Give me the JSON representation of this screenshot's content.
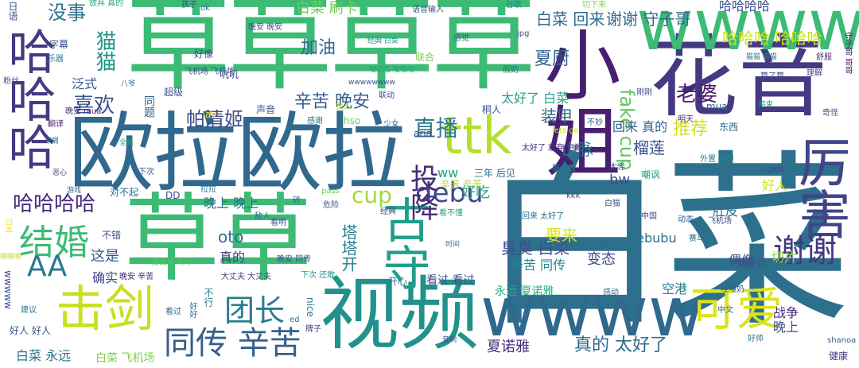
{
  "words": [
    {
      "text": "白菜",
      "color": "#2d708e"
    },
    {
      "text": "草草草草",
      "color": "#3cbb75"
    },
    {
      "text": "欧拉欧拉",
      "color": "#31688e"
    },
    {
      "text": "花音",
      "color": "#443983"
    },
    {
      "text": "小姐",
      "color": "#481f70"
    },
    {
      "text": "草草",
      "color": "#3cbb75"
    },
    {
      "text": "wwwwww",
      "color": "#3cbb75"
    },
    {
      "text": "视频",
      "color": "#21918c"
    },
    {
      "text": "wwww",
      "color": "#31688e"
    },
    {
      "text": "击剑",
      "color": "#c8e020"
    },
    {
      "text": "哈哈哈",
      "color": "#443983"
    },
    {
      "text": "ttk",
      "color": "#b5de2b"
    },
    {
      "text": "古守",
      "color": "#1f9e89"
    },
    {
      "text": "厉害",
      "color": "#414487"
    },
    {
      "text": "可爱",
      "color": "#dde318"
    },
    {
      "text": "结婚",
      "color": "#3cbb75"
    },
    {
      "text": "同传 辛苦",
      "color": "#355f8d"
    },
    {
      "text": "谢谢",
      "color": "#453781"
    },
    {
      "text": "团长",
      "color": "#287d8e"
    },
    {
      "text": "AA",
      "color": "#2a788e"
    },
    {
      "text": "哈哈哈哈",
      "color": "#482878"
    },
    {
      "text": "debu",
      "color": "#3e4989"
    },
    {
      "text": "投降",
      "color": "#472d7b"
    },
    {
      "text": "直播",
      "color": "#2a788e"
    },
    {
      "text": "cup",
      "color": "#a0da39"
    },
    {
      "text": "喜欢",
      "color": "#3b528b"
    },
    {
      "text": "帕清姬",
      "color": "#3e4a89"
    },
    {
      "text": "辛苦 晚安",
      "color": "#355f8d"
    },
    {
      "text": "加油",
      "color": "#30698e"
    },
    {
      "text": "没事",
      "color": "#2c728e"
    },
    {
      "text": "猫猫",
      "color": "#1f958b"
    },
    {
      "text": "夏厨",
      "color": "#32648e"
    },
    {
      "text": "谢谢 守子哥",
      "color": "#2f6c8e"
    },
    {
      "text": "白菜 回来",
      "color": "#2e6f8e"
    },
    {
      "text": "白菜 刷卡",
      "color": "#6ccd5a"
    },
    {
      "text": "哈哈哈 哈哈哈",
      "color": "#cae11f"
    },
    {
      "text": "fake cup",
      "color": "#5ec962"
    },
    {
      "text": "老婆",
      "color": "#481a6c"
    },
    {
      "text": "推荐",
      "color": "#d0e11c"
    },
    {
      "text": "榴莲",
      "color": "#3a538b"
    },
    {
      "text": "回来 真的",
      "color": "#34618d"
    },
    {
      "text": "山脉",
      "color": "#2a768e"
    },
    {
      "text": "装甲",
      "color": "#2e6e8e"
    },
    {
      "text": "太好了 白菜",
      "color": "#20a486"
    },
    {
      "text": "臭臭 白菜",
      "color": "#3b518b"
    },
    {
      "text": "辛苦 同传",
      "color": "#26828e"
    },
    {
      "text": "变态",
      "color": "#404688"
    },
    {
      "text": "好吃",
      "color": "#25ab82"
    },
    {
      "text": "bw",
      "color": "#3c4f8a"
    },
    {
      "text": "ww",
      "color": "#1fa088"
    },
    {
      "text": "晚上 晚上",
      "color": "#2d718e"
    },
    {
      "text": "oto",
      "color": "#2e6d8e"
    },
    {
      "text": "真的",
      "color": "#433e85"
    },
    {
      "text": "这是",
      "color": "#38598c"
    },
    {
      "text": "确实",
      "color": "#3f4788"
    },
    {
      "text": "要来",
      "color": "#d5e21a"
    },
    {
      "text": "debubu",
      "color": "#2e6f8e"
    },
    {
      "text": "空港",
      "color": "#277f8e"
    },
    {
      "text": "切片",
      "color": "#90d743"
    },
    {
      "text": "偶像",
      "color": "#3e4a89"
    },
    {
      "text": "战争",
      "color": "#472f7d"
    },
    {
      "text": "晚上",
      "color": "#3d4d8a"
    },
    {
      "text": "真的 太好了",
      "color": "#2f6b8e"
    },
    {
      "text": "夏诺雅",
      "color": "#46307e"
    },
    {
      "text": "永远 夏诺雅",
      "color": "#27ad81"
    },
    {
      "text": "看过 看过",
      "color": "#3d4e8a"
    },
    {
      "text": "塔塔开",
      "color": "#287c8e"
    },
    {
      "text": "白菜 永远",
      "color": "#2c738e"
    },
    {
      "text": "白菜 飞机场",
      "color": "#7ad151"
    },
    {
      "text": "肚皮",
      "color": "#2f6b8e"
    },
    {
      "text": "好人",
      "color": "#d5e21a"
    },
    {
      "text": "哈哈哈哈",
      "color": "#3b528b"
    },
    {
      "text": "wwwww",
      "color": "#3e4989"
    },
    {
      "text": "日语",
      "color": "#3b528b"
    },
    {
      "text": "放弃 真的",
      "color": "#22a785"
    },
    {
      "text": "孩子",
      "color": "#3f4788"
    },
    {
      "text": "ok",
      "color": "#31688e"
    },
    {
      "text": "语音输入",
      "color": "#3a548c"
    },
    {
      "text": "谷歌",
      "color": "#24878e"
    },
    {
      "text": "切下来",
      "color": "#84d44b"
    },
    {
      "text": "晚安 晚安",
      "color": "#3a548c"
    },
    {
      "text": "jpg",
      "color": "#3b528b"
    },
    {
      "text": "感觉",
      "color": "#2e6e8e"
    },
    {
      "text": "舒服",
      "color": "#472d7b"
    },
    {
      "text": "理解",
      "color": "#3d4e8a"
    },
    {
      "text": "算了算",
      "color": "#3e4c8a"
    },
    {
      "text": "猫猫 猫猫",
      "color": "#277f8e"
    },
    {
      "text": "守子哥 哥哥",
      "color": "#481769"
    },
    {
      "text": "联合",
      "color": "#74d055"
    },
    {
      "text": "假奶",
      "color": "#2a768e"
    },
    {
      "text": "刚刚",
      "color": "#3f4788"
    },
    {
      "text": "叽叽",
      "color": "#404588"
    },
    {
      "text": "声音",
      "color": "#34608d"
    },
    {
      "text": "联动",
      "color": "#38598c"
    },
    {
      "text": "女人",
      "color": "#b8de29"
    },
    {
      "text": "桐人",
      "color": "#3c508b"
    },
    {
      "text": "mua",
      "color": "#355e8d"
    },
    {
      "text": "av",
      "color": "#fde725"
    },
    {
      "text": "hso",
      "color": "#6ece58"
    },
    {
      "text": "aria",
      "color": "#3e4989"
    },
    {
      "text": "感谢",
      "color": "#2c728e"
    },
    {
      "text": "少女",
      "color": "#31688e"
    },
    {
      "text": "太好了 放弃 抱歉",
      "color": "#472a7a"
    },
    {
      "text": "不妙",
      "color": "#32648e"
    },
    {
      "text": "lets go",
      "color": "#c2df23"
    },
    {
      "text": "明天",
      "color": "#46337f"
    },
    {
      "text": "东西",
      "color": "#2f6c8e"
    },
    {
      "text": "晚安 mua",
      "color": "#472f7d"
    },
    {
      "text": "翻译",
      "color": "#482071"
    },
    {
      "text": "好像",
      "color": "#3b528b"
    },
    {
      "text": "字幕",
      "color": "#3b528b"
    },
    {
      "text": "乐器",
      "color": "#2a788e"
    },
    {
      "text": "粉丝",
      "color": "#3e4a89"
    },
    {
      "text": "超级",
      "color": "#3c4f8a"
    },
    {
      "text": "同题",
      "color": "#34618d"
    },
    {
      "text": "泛式",
      "color": "#38588c"
    },
    {
      "text": "经典 白菜",
      "color": "#1f988b"
    },
    {
      "text": "哈哈哈 哈哈哈",
      "color": "#20a386"
    },
    {
      "text": "wwwwwwww",
      "color": "#3b528b"
    },
    {
      "text": "对不起",
      "color": "#2e6f8e"
    },
    {
      "text": "下次",
      "color": "#3b528b"
    },
    {
      "text": "全是",
      "color": "#1fa088"
    },
    {
      "text": "恶心",
      "color": "#3d4d8a"
    },
    {
      "text": "DD",
      "color": "#3e4a89"
    },
    {
      "text": "拉拉",
      "color": "#2a788e"
    },
    {
      "text": "砖",
      "color": "#2c738e"
    },
    {
      "text": "pass",
      "color": "#6ccd5a"
    },
    {
      "text": "危险",
      "color": "#3b528b"
    },
    {
      "text": "辛苦 辛苦",
      "color": "#b5de2b"
    },
    {
      "text": "三年 后见",
      "color": "#2d708e"
    },
    {
      "text": "看不懂",
      "color": "#20a486"
    },
    {
      "text": "经典",
      "color": "#3c508b"
    },
    {
      "text": "回来 太好了",
      "color": "#2c738e"
    },
    {
      "text": "kkk",
      "color": "#3c508b"
    },
    {
      "text": "白猫",
      "color": "#3b528b"
    },
    {
      "text": "中国",
      "color": "#3e4c8a"
    },
    {
      "text": "动态",
      "color": "#355f8d"
    },
    {
      "text": "飞机场",
      "color": "#3e4a89"
    },
    {
      "text": "赛马",
      "color": "#2d708e"
    },
    {
      "text": "我爱你",
      "color": "#3d4e8a"
    },
    {
      "text": "哇嘎奶",
      "color": "#33628d"
    },
    {
      "text": "中文",
      "color": "#33628d"
    },
    {
      "text": "好帅",
      "color": "#2a788e"
    },
    {
      "text": "健康",
      "color": "#44397f"
    },
    {
      "text": "shanoa",
      "color": "#34618d"
    },
    {
      "text": "DNA",
      "color": "#3e4a89"
    },
    {
      "text": "嘲讽",
      "color": "#1fa088"
    },
    {
      "text": "外置 装甲",
      "color": "#26828e"
    },
    {
      "text": "太怪",
      "color": "#3e4c8a"
    },
    {
      "text": "腹太鼓",
      "color": "#2a788e"
    },
    {
      "text": "sao",
      "color": "#33638d"
    },
    {
      "text": "漫画家 助手",
      "color": "#4fc46a"
    },
    {
      "text": "看过",
      "color": "#2f6c8e"
    },
    {
      "text": "好好",
      "color": "#2e6f8e"
    },
    {
      "text": "不行",
      "color": "#26828e"
    },
    {
      "text": "大丈夫 大丈夫",
      "color": "#3f4788"
    },
    {
      "text": "下次 还敢",
      "color": "#1f9a8a"
    },
    {
      "text": "nice",
      "color": "#2d718e"
    },
    {
      "text": "牌子",
      "color": "#453781"
    },
    {
      "text": "音响",
      "color": "#3a548c"
    },
    {
      "text": "开心",
      "color": "#2c738e"
    },
    {
      "text": "感动",
      "color": "#2e6e8e"
    },
    {
      "text": "晚安 同传",
      "color": "#3c508b"
    },
    {
      "text": "晚安 辛苦",
      "color": "#482475"
    },
    {
      "text": "好人 好人",
      "color": "#3a548c"
    },
    {
      "text": "建议",
      "color": "#2d708e"
    },
    {
      "text": "ed",
      "color": "#2f6b8e"
    },
    {
      "text": "看明",
      "color": "#3c4f8a"
    },
    {
      "text": "敌人",
      "color": "#2e6e8e"
    },
    {
      "text": "不错",
      "color": "#3d4e8a"
    },
    {
      "text": "日本",
      "color": "#fde725"
    },
    {
      "text": "啊啊啊",
      "color": "#c0df25"
    },
    {
      "text": "游戏",
      "color": "#31688e"
    },
    {
      "text": "草屑",
      "color": "#2d708e"
    },
    {
      "text": "奇怪",
      "color": "#3b528b"
    },
    {
      "text": "结束",
      "color": "#22a785"
    },
    {
      "text": "八爷",
      "color": "#31688e"
    },
    {
      "text": "飞机场 飞机场",
      "color": "#3e4a89"
    },
    {
      "text": "W",
      "color": "#2a788e"
    },
    {
      "text": "时间",
      "color": "#2c738e"
    }
  ]
}
